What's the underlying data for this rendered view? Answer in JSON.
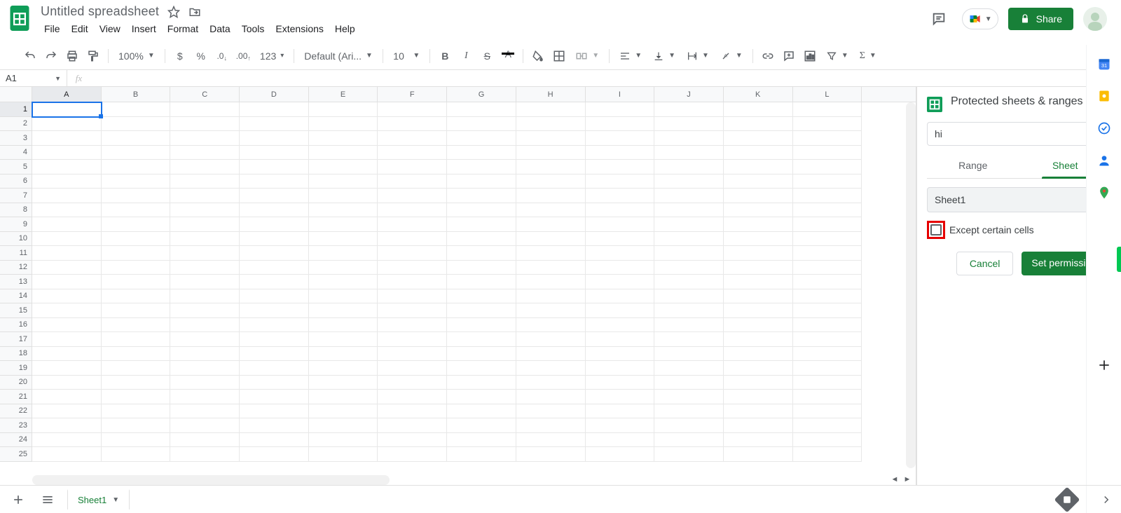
{
  "header": {
    "doc_title": "Untitled spreadsheet",
    "share_label": "Share"
  },
  "menubar": {
    "items": [
      "File",
      "Edit",
      "View",
      "Insert",
      "Format",
      "Data",
      "Tools",
      "Extensions",
      "Help"
    ]
  },
  "toolbar": {
    "zoom": "100%",
    "format_123": "123",
    "font": "Default (Ari...",
    "font_size": "10"
  },
  "formula_bar": {
    "cell_ref": "A1",
    "fx_label": "fx",
    "value": ""
  },
  "grid": {
    "columns": [
      "A",
      "B",
      "C",
      "D",
      "E",
      "F",
      "G",
      "H",
      "I",
      "J",
      "K",
      "L"
    ],
    "row_count": 25,
    "selected_col": "A",
    "selected_row": 1
  },
  "sidepanel": {
    "title": "Protected sheets & ranges",
    "description_value": "hi",
    "tabs": {
      "range": "Range",
      "sheet": "Sheet",
      "active": "sheet"
    },
    "sheet_select": "Sheet1",
    "except_label": "Except certain cells",
    "cancel_label": "Cancel",
    "set_perms_label": "Set permissions"
  },
  "footer": {
    "sheet_tab": "Sheet1"
  }
}
